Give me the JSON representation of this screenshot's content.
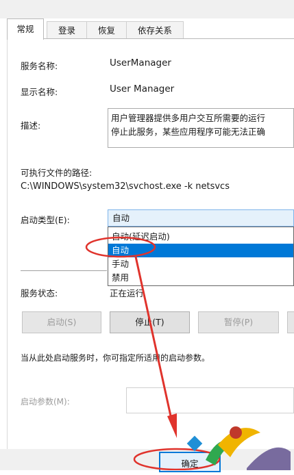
{
  "tabs": [
    {
      "label": "常规",
      "active": true
    },
    {
      "label": "登录",
      "active": false
    },
    {
      "label": "恢复",
      "active": false
    },
    {
      "label": "依存关系",
      "active": false
    }
  ],
  "general": {
    "service_name_label": "服务名称:",
    "service_name_value": "UserManager",
    "display_name_label": "显示名称:",
    "display_name_value": "User Manager",
    "description_label": "描述:",
    "description_line1": "用户管理器提供多用户交互所需要的运行",
    "description_line2": "停止此服务，某些应用程序可能无法正确",
    "exe_path_label": "可执行文件的路径:",
    "exe_path_value": "C:\\WINDOWS\\system32\\svchost.exe -k netsvcs",
    "startup_type_label": "启动类型(E):",
    "startup_type_selected": "自动",
    "startup_type_options": [
      "自动(延迟启动)",
      "自动",
      "手动",
      "禁用"
    ],
    "service_status_label": "服务状态:",
    "service_status_value": "正在运行",
    "buttons": {
      "start": "启动(S)",
      "stop": "停止(T)",
      "pause": "暂停(P)"
    },
    "hint_text": "当从此处启动服务时，你可指定所适用的启动参数。",
    "start_params_label": "启动参数(M):",
    "start_params_value": ""
  },
  "footer": {
    "ok_label": "确定"
  },
  "colors": {
    "accent": "#0078d7",
    "annotation": "#e0332c"
  }
}
